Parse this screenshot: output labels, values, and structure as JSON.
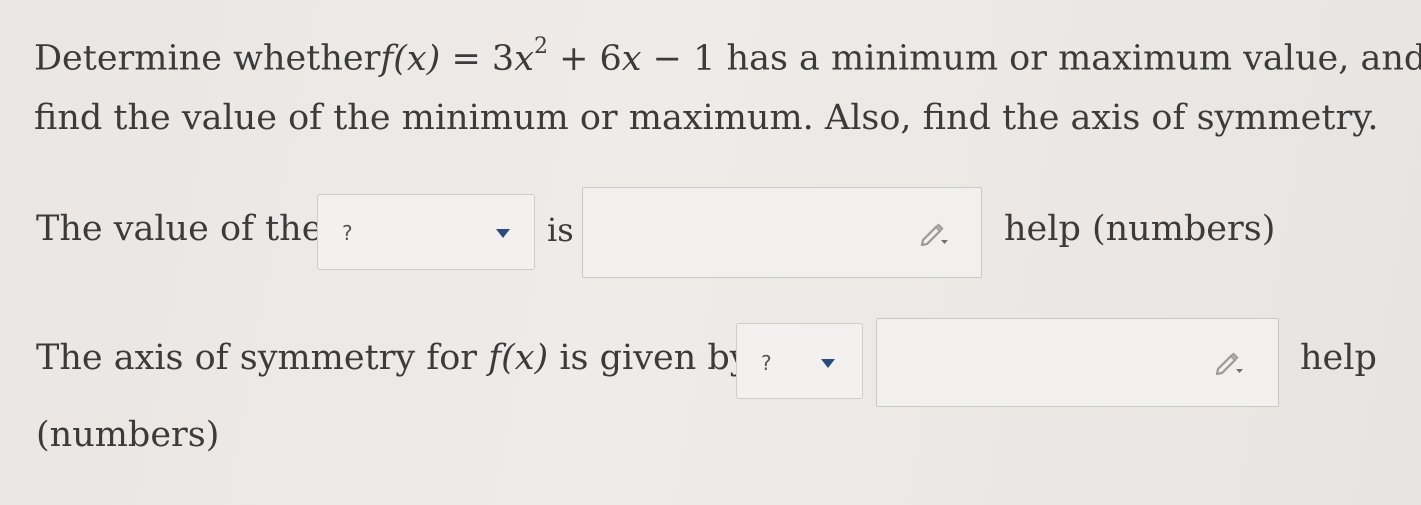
{
  "question": {
    "line1_prefix": "Determine whether",
    "func": "f(x)",
    "eq": " = 3",
    "var1": "x",
    "exp": "2",
    "plus": " + 6",
    "var2": "x",
    "minus": " − 1",
    "line1_suffix": " has a minimum or maximum value, and",
    "line2": "find the value of the minimum or maximum. Also, find the axis of symmetry."
  },
  "row1": {
    "prefix": "The value of the",
    "select_value": "?",
    "is_label": "is",
    "answer_value": "",
    "help_label": "help (numbers)"
  },
  "row2": {
    "prefix": "The axis of symmetry for",
    "func": "f(x)",
    "suffix": "is given by",
    "select_value": "?",
    "answer_value": "",
    "help_label": "help",
    "help_cont": "(numbers)"
  },
  "icons": {
    "dropdown": "chevron-down-icon",
    "pencil": "pencil-icon"
  },
  "colors": {
    "background": "#ebe9e7",
    "text": "#3b3b3b",
    "caret": "#2c4a7a",
    "input_border": "#cbc9c6"
  }
}
